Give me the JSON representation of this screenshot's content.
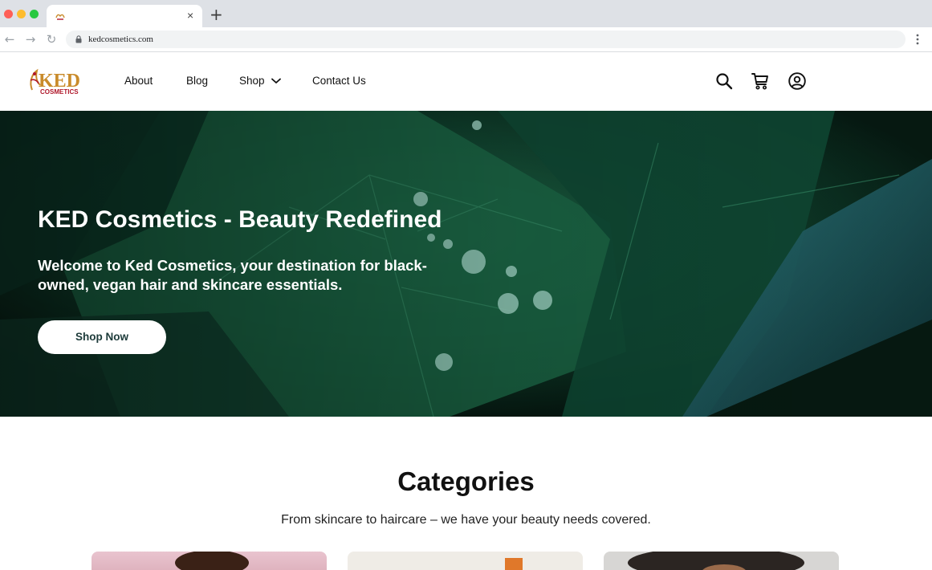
{
  "browser": {
    "tab_close_glyph": "×",
    "new_tab_glyph": "+",
    "back_glyph": "←",
    "forward_glyph": "→",
    "reload_glyph": "↻",
    "url": "kedcosmetics.com",
    "icons": [
      "lock-icon",
      "menu-dots-icon",
      "favicon-icon"
    ]
  },
  "header": {
    "nav": {
      "about": "About",
      "blog": "Blog",
      "shop": "Shop",
      "contact": "Contact Us"
    },
    "icons": [
      "search-icon",
      "cart-icon",
      "account-icon",
      "chevron-down-icon"
    ],
    "logo": {
      "main": "KED",
      "tagline": "COSMETICS"
    }
  },
  "hero": {
    "title": "KED Cosmetics - Beauty Redefined",
    "subtitle": "Welcome to Ked Cosmetics, your destination for black-owned, vegan hair and skincare essentials.",
    "cta": "Shop Now"
  },
  "categories": {
    "title": "Categories",
    "subtitle": "From skincare to haircare – we have your beauty needs covered."
  },
  "colors": {
    "cta_text": "#1d3b3a",
    "hero_bg": "#0b2a1e",
    "logo_gold": "#c98b2b",
    "logo_red": "#b0182b"
  }
}
